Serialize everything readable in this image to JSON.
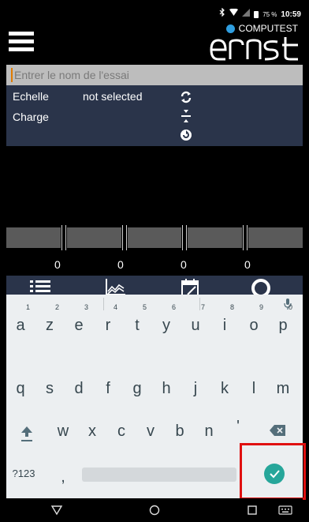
{
  "status_bar": {
    "icons": [
      "bluetooth-icon",
      "wifi-icon",
      "signal-icon",
      "battery-icon"
    ],
    "battery_percent": "75 %",
    "time": "10:59"
  },
  "header": {
    "menu_icon": "hamburger-menu-icon",
    "brand_text": "COMPUTEST",
    "brand_logo_text": "ernst"
  },
  "test_name": {
    "placeholder": "Entrer le nom de l'essai",
    "value": ""
  },
  "info": {
    "scale_label": "Echelle",
    "scale_value": "not selected",
    "load_label": "Charge",
    "icons": [
      "refresh-icon",
      "divide-icon",
      "reset-icon"
    ]
  },
  "measurements": {
    "values": [
      "0",
      "0",
      "0",
      "0"
    ]
  },
  "nav": {
    "items": [
      "list-icon",
      "chart-icon",
      "calendar-icon",
      "location-icon"
    ]
  },
  "keyboard": {
    "row1": [
      {
        "key": "a",
        "hint": "1"
      },
      {
        "key": "z",
        "hint": "2"
      },
      {
        "key": "e",
        "hint": "3"
      },
      {
        "key": "r",
        "hint": "4"
      },
      {
        "key": "t",
        "hint": "5"
      },
      {
        "key": "y",
        "hint": "6"
      },
      {
        "key": "u",
        "hint": "7"
      },
      {
        "key": "i",
        "hint": "8"
      },
      {
        "key": "o",
        "hint": "9"
      },
      {
        "key": "p",
        "hint": "0"
      }
    ],
    "row2": [
      "q",
      "s",
      "d",
      "f",
      "g",
      "h",
      "j",
      "k",
      "l",
      "m"
    ],
    "row3": [
      "w",
      "x",
      "c",
      "v",
      "b",
      "n",
      "'"
    ],
    "symbols_key": "?123",
    "comma_key": ",",
    "accent_color": "#26a69a",
    "highlight_color": "#e01010"
  },
  "colors": {
    "panel_bg": "#2a344a",
    "brand_blue": "#2f9ee0"
  }
}
